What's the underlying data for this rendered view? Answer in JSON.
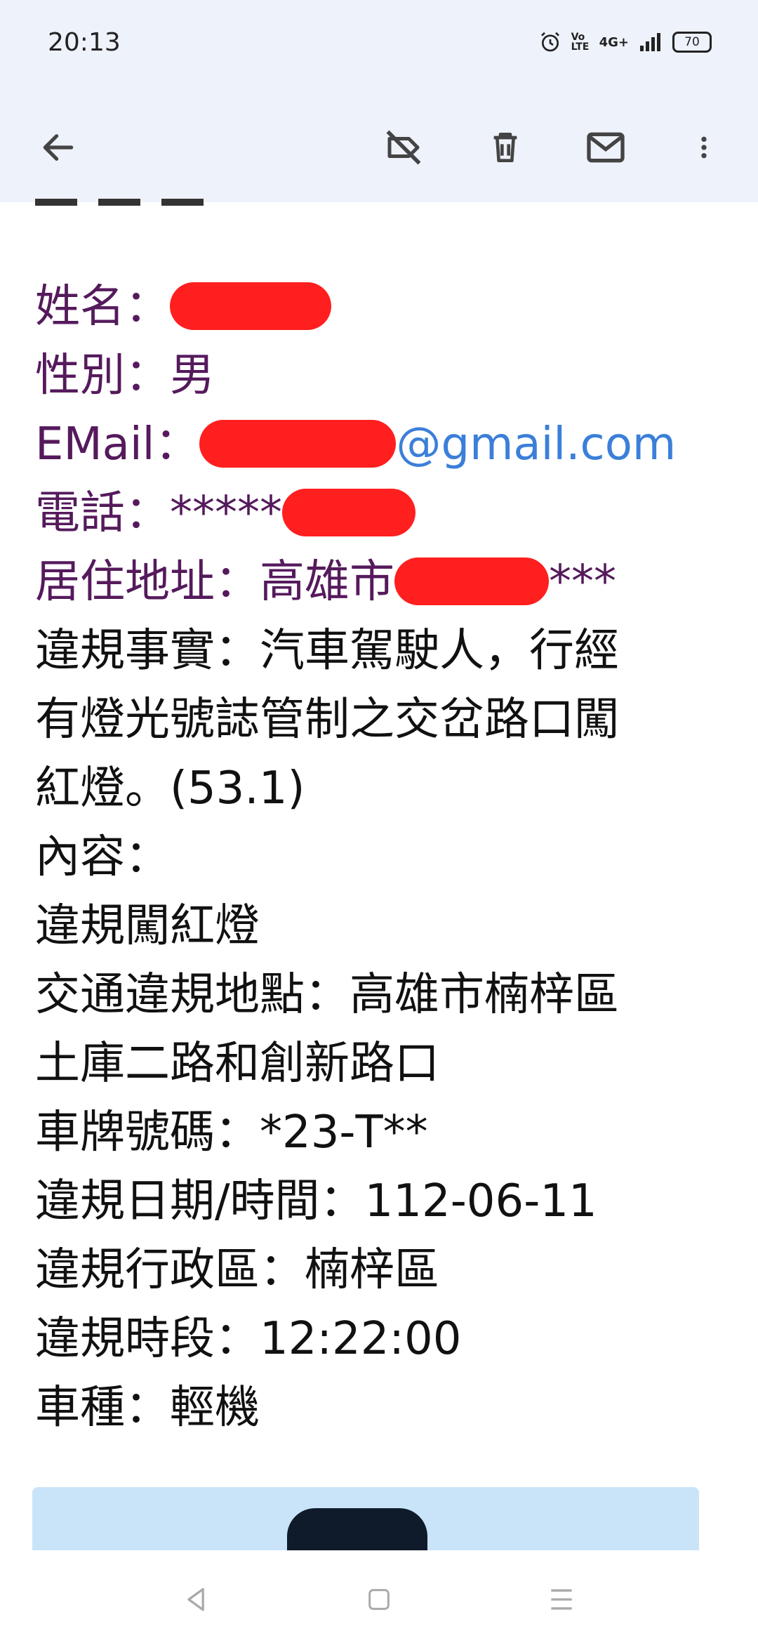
{
  "status_bar": {
    "time": "20:13",
    "signal_label": "4G+",
    "volte_label": "Vo LTE",
    "battery": "70"
  },
  "toolbar": {
    "back_icon": "arrow-left-icon",
    "label_off_icon": "label-off-icon",
    "delete_icon": "trash-icon",
    "mail_icon": "mail-icon",
    "more_icon": "more-vertical-icon"
  },
  "email_body": {
    "name_label": "姓名：",
    "gender_label": "性別：",
    "gender_value": "男",
    "email_label": "EMail：",
    "email_domain": "@gmail.com",
    "phone_label": "電話：",
    "phone_value": "*****",
    "address_label": "居住地址：",
    "address_city": "高雄市",
    "address_tail": "***",
    "violation_fact_line1": "違規事實：汽車駕駛人，行經",
    "violation_fact_line2": "有燈光號誌管制之交岔路口闖",
    "violation_fact_line3": "紅燈。(53.1)",
    "content_label": "內容：",
    "content_value": "違規闖紅燈",
    "location_line1": "交通違規地點：高雄市楠梓區",
    "location_line2": "土庫二路和創新路口",
    "plate": "車牌號碼：*23-T**",
    "date_time": "違規日期/時間：112-06-11",
    "district": "違規行政區：楠梓區",
    "time_period": "違規時段：12:22:00",
    "vehicle_type": "車種：輕機"
  },
  "colors": {
    "purple_text": "#551a5c",
    "link": "#3b7fd8",
    "redaction": "#ff1f1f",
    "toolbar_bg": "#eef2fa"
  },
  "nav_bar": {
    "back_icon": "nav-back-icon",
    "home_icon": "nav-home-icon",
    "recents_icon": "nav-menu-icon"
  }
}
